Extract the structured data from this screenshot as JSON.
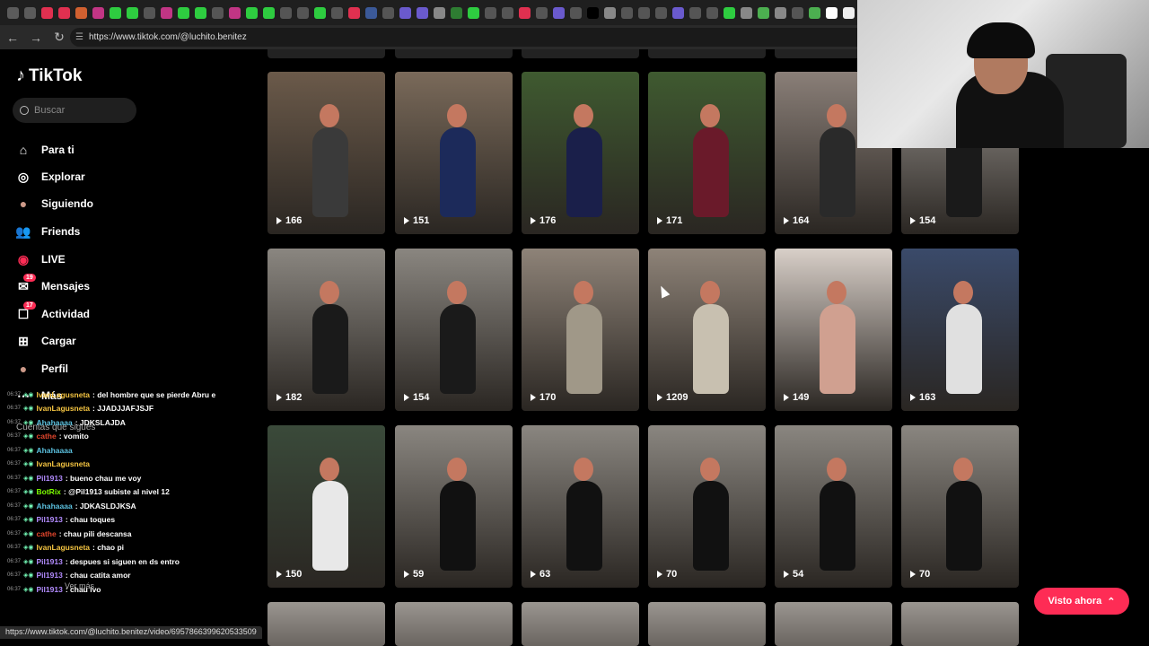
{
  "browser": {
    "url": "https://www.tiktok.com/@luchito.benitez",
    "status_url": "https://www.tiktok.com/@luchito.benitez/video/6957866399620533509",
    "tab_colors": [
      "#5b5b5b",
      "#5b5b5b",
      "#e03050",
      "#e03050",
      "#d06030",
      "#c13584",
      "#2ecc40",
      "#2ecc40",
      "#555",
      "#c13584",
      "#2ecc40",
      "#2ecc40",
      "#555",
      "#c13584",
      "#2ecc40",
      "#2ecc40",
      "#555",
      "#555",
      "#2ecc40",
      "#555",
      "#e03050",
      "#3b5998",
      "#555",
      "#6a5acd",
      "#6a5acd",
      "#888",
      "#2e7d32",
      "#2ecc40",
      "#555",
      "#555",
      "#e03050",
      "#555",
      "#6a5acd",
      "#555",
      "#000",
      "#888",
      "#555",
      "#555",
      "#555",
      "#6a5acd",
      "#555",
      "#555",
      "#2ecc40",
      "#888",
      "#4caf50",
      "#888",
      "#555",
      "#4caf50",
      "#fff",
      "#eee",
      "#ffcc00",
      "#555",
      "#fff",
      "#fff"
    ]
  },
  "sidebar": {
    "logo": "TikTok",
    "search_placeholder": "Buscar",
    "items": [
      {
        "label": "Para ti",
        "icon": "home-icon",
        "badge": ""
      },
      {
        "label": "Explorar",
        "icon": "compass-icon",
        "badge": ""
      },
      {
        "label": "Siguiendo",
        "icon": "avatar-icon",
        "badge": ""
      },
      {
        "label": "Friends",
        "icon": "friends-icon",
        "badge": ""
      },
      {
        "label": "LIVE",
        "icon": "live-icon",
        "badge": ""
      },
      {
        "label": "Mensajes",
        "icon": "messages-icon",
        "badge": "19"
      },
      {
        "label": "Actividad",
        "icon": "activity-icon",
        "badge": "17"
      },
      {
        "label": "Cargar",
        "icon": "upload-icon",
        "badge": ""
      },
      {
        "label": "Perfil",
        "icon": "profile-icon",
        "badge": ""
      },
      {
        "label": "Más",
        "icon": "more-icon",
        "badge": ""
      }
    ],
    "following_header": "Cuentas que sigues",
    "ver_mas": "Ver más"
  },
  "chat": [
    {
      "time": "06:37",
      "user": "IvanLagusneta",
      "color": "#f5c542",
      "msg": ": del hombre que se pierde Abru e"
    },
    {
      "time": "06:37",
      "user": "IvanLagusneta",
      "color": "#f5c542",
      "msg": ": JJADJJAFJSJF"
    },
    {
      "time": "06:37",
      "user": "Ahahaaaa",
      "color": "#5bc0de",
      "msg": ": JDKSLAJDA"
    },
    {
      "time": "06:37",
      "user": "cathe",
      "color": "#e0452c",
      "msg": ": vomito"
    },
    {
      "time": "06:37",
      "user": "Ahahaaaa",
      "color": "#5bc0de",
      "msg": ""
    },
    {
      "time": "06:37",
      "user": "IvanLagusneta",
      "color": "#f5c542",
      "msg": ""
    },
    {
      "time": "06:37",
      "user": "Pil1913",
      "color": "#b38cff",
      "msg": ": bueno chau me voy"
    },
    {
      "time": "06:37",
      "user": "BotRix",
      "color": "#7cfc00",
      "msg": ": @Pil1913 subiste al nivel 12"
    },
    {
      "time": "06:37",
      "user": "Ahahaaaa",
      "color": "#5bc0de",
      "msg": ": JDKASLDJKSA"
    },
    {
      "time": "06:37",
      "user": "Pil1913",
      "color": "#b38cff",
      "msg": ": chau toques"
    },
    {
      "time": "06:37",
      "user": "cathe",
      "color": "#e0452c",
      "msg": ": chau pili descansa"
    },
    {
      "time": "06:37",
      "user": "IvanLagusneta",
      "color": "#f5c542",
      "msg": ": chao pi"
    },
    {
      "time": "06:37",
      "user": "Pil1913",
      "color": "#b38cff",
      "msg": ": despues si siguen en ds entro"
    },
    {
      "time": "06:37",
      "user": "Pil1913",
      "color": "#b38cff",
      "msg": ": chau catita amor"
    },
    {
      "time": "06:37",
      "user": "Pil1913",
      "color": "#b38cff",
      "msg": ": chau ivo"
    }
  ],
  "videos": [
    {
      "views": "166",
      "bg": "#6b5a4a",
      "shirt": "#3a3a3a"
    },
    {
      "views": "151",
      "bg": "#7a6a5a",
      "shirt": "#1c2a5a"
    },
    {
      "views": "176",
      "bg": "#3f5a30",
      "shirt": "#1a1f4a"
    },
    {
      "views": "171",
      "bg": "#3f5a30",
      "shirt": "#6a1a2a"
    },
    {
      "views": "164",
      "bg": "#8a7f78",
      "shirt": "#2a2a2a"
    },
    {
      "views": "154",
      "bg": "#9a9590",
      "shirt": "#1a1a1a"
    },
    {
      "views": "182",
      "bg": "#8a8680",
      "shirt": "#1a1a1a"
    },
    {
      "views": "154",
      "bg": "#8a8680",
      "shirt": "#1a1a1a"
    },
    {
      "views": "170",
      "bg": "#8e8378",
      "shirt": "#a09888"
    },
    {
      "views": "1209",
      "bg": "#8e8378",
      "shirt": "#c8c0b0"
    },
    {
      "views": "149",
      "bg": "#d8cfc8",
      "shirt": "#d0a090"
    },
    {
      "views": "163",
      "bg": "#3a4a6a",
      "shirt": "#e0e0e0"
    },
    {
      "views": "150",
      "bg": "#3a4a3a",
      "shirt": "#e8e8e8"
    },
    {
      "views": "59",
      "bg": "#8a8680",
      "shirt": "#111111"
    },
    {
      "views": "63",
      "bg": "#8a8680",
      "shirt": "#111111"
    },
    {
      "views": "70",
      "bg": "#8a8680",
      "shirt": "#111111"
    },
    {
      "views": "54",
      "bg": "#8a8680",
      "shirt": "#111111"
    },
    {
      "views": "70",
      "bg": "#8a8680",
      "shirt": "#111111"
    }
  ],
  "watch_now": "Visto ahora"
}
